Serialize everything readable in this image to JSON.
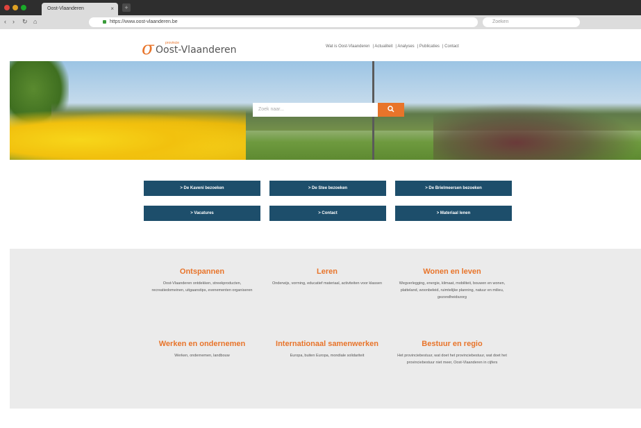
{
  "browser": {
    "tab_title": "Oost-Vlaanderen",
    "tab_close": "×",
    "new_tab": "+",
    "nav": {
      "back": "‹",
      "forward": "›",
      "reload": "↻",
      "home": "⌂"
    },
    "url": "https://www.oost-vlaanderen.be",
    "search_placeholder": "Zoeken"
  },
  "site": {
    "logo_main": "Oost-Vlaanderen",
    "logo_small": "provincie",
    "nav_items": [
      "Wat is Oost-Vlaanderen",
      "Actualiteit",
      "Analyses",
      "Publicaties",
      "Contact"
    ],
    "search_placeholder": "Zoek naar...",
    "search_icon": "search-icon",
    "buttons": [
      [
        "> De Kaveni bezoeken",
        "> De Stee bezoeken",
        "> De Brielmeersen bezoeken"
      ],
      [
        "> Vacatures",
        "> Contact",
        "> Materiaal lenen"
      ]
    ],
    "categories": [
      {
        "title": "Ontspannen",
        "text": "Oost-Vlaanderen ontdekken, streekproducten, recreatiedomeinen, uitgaanstips, evenementen organiseren"
      },
      {
        "title": "Leren",
        "text": "Onderwijs, vorming, educatief materiaal, activiteiten voor klassen"
      },
      {
        "title": "Wonen en leven",
        "text": "Wegverlegging, energie, klimaat, mobiliteit, bouwen en wonen, platteland, woonbeleid, ruimtelijke planning, natuur en milieu, gezondheidszorg"
      },
      {
        "title": "Werken en ondernemen",
        "text": "Werken, ondernemen, landbouw"
      },
      {
        "title": "Internationaal samenwerken",
        "text": "Europa, buiten Europa, mondiale solidariteit"
      },
      {
        "title": "Bestuur en regio",
        "text": "Het provinciebestuur, wat doet het provinciebestuur, wat doet het provinciebestuur niet meer, Oost-Vlaanderen in cijfers"
      }
    ]
  },
  "colors": {
    "accent": "#e8742a",
    "button": "#1d4e6b",
    "gray_band": "#ebebeb"
  }
}
